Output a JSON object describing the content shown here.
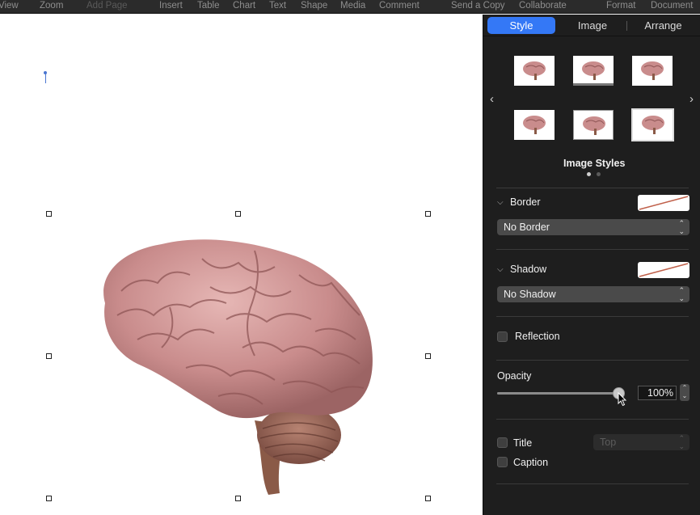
{
  "toolbar": {
    "items": [
      "View",
      "Zoom",
      "Add Page",
      "Insert",
      "Table",
      "Chart",
      "Text",
      "Shape",
      "Media",
      "Comment",
      "Send a Copy",
      "Collaborate",
      "Format",
      "Document"
    ],
    "disabled": [
      "Add Page"
    ]
  },
  "inspector": {
    "tabs": [
      {
        "label": "Style",
        "active": true
      },
      {
        "label": "Image",
        "active": false
      },
      {
        "label": "Arrange",
        "active": false
      }
    ],
    "image_styles_label": "Image Styles",
    "page_indicator": {
      "pages": 2,
      "current": 1
    },
    "border": {
      "label": "Border",
      "value": "No Border"
    },
    "shadow": {
      "label": "Shadow",
      "value": "No Shadow"
    },
    "reflection": {
      "label": "Reflection",
      "checked": false
    },
    "opacity": {
      "label": "Opacity",
      "value_text": "100%",
      "fraction": 1.0
    },
    "title": {
      "label": "Title",
      "checked": false,
      "position": "Top"
    },
    "caption": {
      "label": "Caption",
      "checked": false
    }
  },
  "colors": {
    "accent": "#3478f6",
    "panel": "#1e1e1e",
    "brain": "#c98c8c"
  },
  "icons": {
    "prev": "chevron-left-icon",
    "next": "chevron-right-icon",
    "collapse": "chevron-down-icon",
    "popup": "updown-chevron-icon"
  }
}
